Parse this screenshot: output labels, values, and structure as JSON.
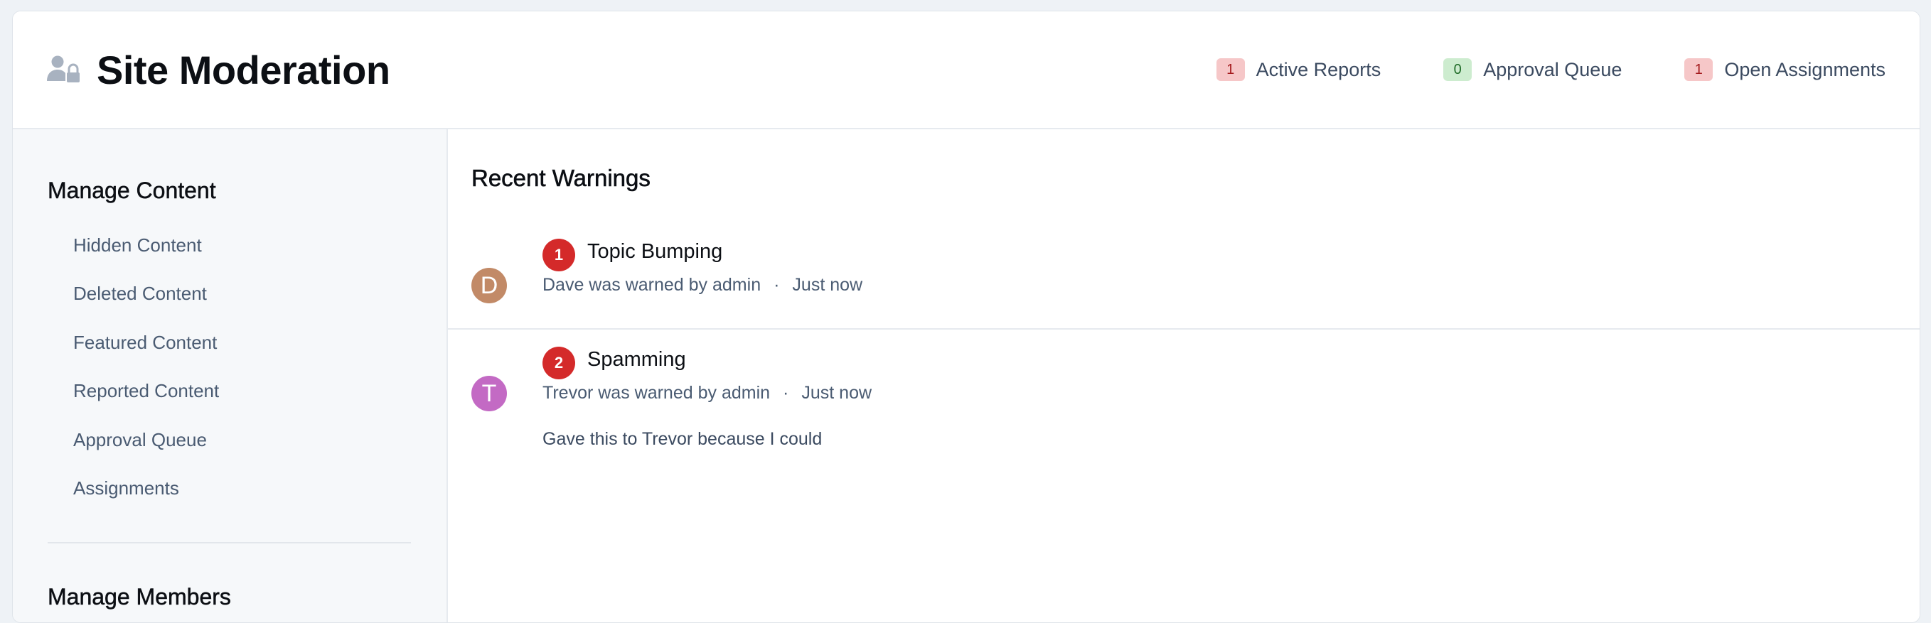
{
  "header": {
    "title": "Site Moderation",
    "icon": "user-lock-icon",
    "stats": [
      {
        "count": "1",
        "label": "Active Reports",
        "badge_bg": "#f6c7c8",
        "badge_fg": "#a3191c"
      },
      {
        "count": "0",
        "label": "Approval Queue",
        "badge_bg": "#cdeccf",
        "badge_fg": "#1f6b27"
      },
      {
        "count": "1",
        "label": "Open Assignments",
        "badge_bg": "#f6c7c8",
        "badge_fg": "#a3191c"
      }
    ]
  },
  "sidebar": {
    "manage_content": {
      "heading": "Manage Content",
      "items": [
        {
          "label": "Hidden Content"
        },
        {
          "label": "Deleted Content"
        },
        {
          "label": "Featured Content"
        },
        {
          "label": "Reported Content"
        },
        {
          "label": "Approval Queue"
        },
        {
          "label": "Assignments"
        }
      ]
    },
    "manage_members": {
      "heading": "Manage Members"
    }
  },
  "main": {
    "section_title": "Recent Warnings",
    "warnings": [
      {
        "avatar_letter": "D",
        "avatar_color": "#c28a67",
        "points": "1",
        "title": "Topic Bumping",
        "meta": "Dave was warned by admin",
        "separator": "·",
        "time": "Just now",
        "note": ""
      },
      {
        "avatar_letter": "T",
        "avatar_color": "#c36ac4",
        "points": "2",
        "title": "Spamming",
        "meta": "Trevor was warned by admin",
        "separator": "·",
        "time": "Just now",
        "note": "Gave this to Trevor because I could"
      }
    ]
  }
}
